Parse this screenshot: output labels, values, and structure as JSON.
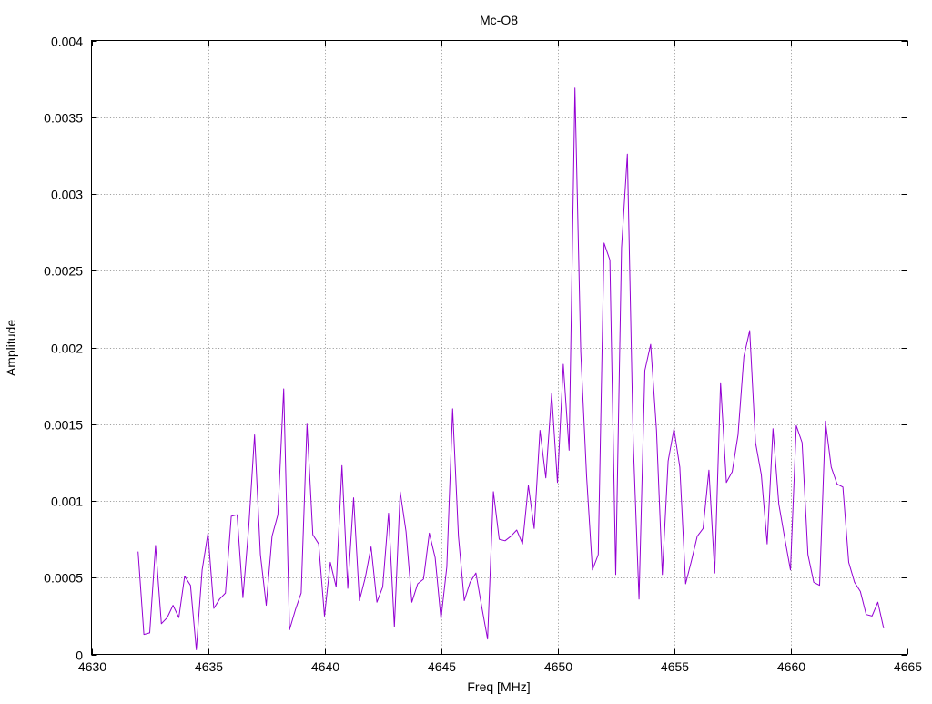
{
  "chart_data": {
    "type": "line",
    "title": "Mc-O8",
    "xlabel": "Freq [MHz]",
    "ylabel": "Amplitude",
    "xlim": [
      4630,
      4665
    ],
    "ylim": [
      0,
      0.004
    ],
    "xticks": [
      "4630",
      "4635",
      "4640",
      "4645",
      "4650",
      "4655",
      "4660",
      "4665"
    ],
    "yticks": [
      "0",
      "0.0005",
      "0.001",
      "0.0015",
      "0.002",
      "0.0025",
      "0.003",
      "0.0035",
      "0.004"
    ],
    "grid": true,
    "series_color": "#9400d3",
    "series": [
      {
        "x": [
          4632.0,
          4632.25,
          4632.5,
          4632.75,
          4633.0,
          4633.25,
          4633.5,
          4633.75,
          4634.0,
          4634.25,
          4634.5,
          4634.75,
          4635.0,
          4635.25,
          4635.5,
          4635.75,
          4636.0,
          4636.25,
          4636.5,
          4636.75,
          4637.0,
          4637.25,
          4637.5,
          4637.75,
          4638.0,
          4638.25,
          4638.5,
          4638.75,
          4639.0,
          4639.25,
          4639.5,
          4639.75,
          4640.0,
          4640.25,
          4640.5,
          4640.75,
          4641.0,
          4641.25,
          4641.5,
          4641.75,
          4642.0,
          4642.25,
          4642.5,
          4642.75,
          4643.0,
          4643.25,
          4643.5,
          4643.75,
          4644.0,
          4644.25,
          4644.5,
          4644.75,
          4645.0,
          4645.25,
          4645.5,
          4645.75,
          4646.0,
          4646.25,
          4646.5,
          4646.75,
          4647.0,
          4647.25,
          4647.5,
          4647.75,
          4648.0,
          4648.25,
          4648.5,
          4648.75,
          4649.0,
          4649.25,
          4649.5,
          4649.75,
          4650.0,
          4650.25,
          4650.5,
          4650.75,
          4651.0,
          4651.25,
          4651.5,
          4651.75,
          4652.0,
          4652.25,
          4652.5,
          4652.75,
          4653.0,
          4653.25,
          4653.5,
          4653.75,
          4654.0,
          4654.25,
          4654.5,
          4654.75,
          4655.0,
          4655.25,
          4655.5,
          4655.75,
          4656.0,
          4656.25,
          4656.5,
          4656.75,
          4657.0,
          4657.25,
          4657.5,
          4657.75,
          4658.0,
          4658.25,
          4658.5,
          4658.75,
          4659.0,
          4659.25,
          4659.5,
          4659.75,
          4660.0,
          4660.25,
          4660.5,
          4660.75,
          4661.0,
          4661.25,
          4661.5,
          4661.75,
          4662.0,
          4662.25,
          4662.5,
          4662.75,
          4663.0,
          4663.25,
          4663.5,
          4663.75,
          4664.0
        ],
        "y": [
          0.00067,
          0.00013,
          0.00014,
          0.00071,
          0.0002,
          0.00024,
          0.00032,
          0.00024,
          0.00051,
          0.00045,
          3e-05,
          0.00055,
          0.00079,
          0.0003,
          0.00036,
          0.0004,
          0.0009,
          0.00091,
          0.00037,
          0.00083,
          0.00143,
          0.00065,
          0.00032,
          0.00077,
          0.00091,
          0.00173,
          0.00016,
          0.00029,
          0.0004,
          0.0015,
          0.00078,
          0.00072,
          0.00025,
          0.0006,
          0.00044,
          0.00123,
          0.00043,
          0.00102,
          0.00035,
          0.0005,
          0.0007,
          0.00034,
          0.00044,
          0.00092,
          0.00018,
          0.00106,
          0.0008,
          0.00034,
          0.00046,
          0.00049,
          0.00079,
          0.00063,
          0.00023,
          0.00057,
          0.0016,
          0.00077,
          0.00035,
          0.00047,
          0.00053,
          0.00031,
          0.0001,
          0.00106,
          0.00075,
          0.00074,
          0.00077,
          0.00081,
          0.00072,
          0.0011,
          0.00082,
          0.00146,
          0.00115,
          0.0017,
          0.00112,
          0.00189,
          0.00133,
          0.00369,
          0.00197,
          0.00116,
          0.00055,
          0.00065,
          0.00268,
          0.00257,
          0.00052,
          0.00265,
          0.00326,
          0.00139,
          0.00036,
          0.00185,
          0.00202,
          0.00146,
          0.00052,
          0.00126,
          0.00147,
          0.00122,
          0.00046,
          0.00061,
          0.00077,
          0.00082,
          0.0012,
          0.00053,
          0.00177,
          0.00112,
          0.00119,
          0.00143,
          0.00194,
          0.00211,
          0.00138,
          0.00117,
          0.00072,
          0.00147,
          0.00098,
          0.00076,
          0.00055,
          0.00149,
          0.00138,
          0.00065,
          0.00047,
          0.00045,
          0.00152,
          0.00122,
          0.00111,
          0.00109,
          0.0006,
          0.00047,
          0.00041,
          0.00026,
          0.00025,
          0.00034,
          0.00017
        ]
      }
    ]
  }
}
